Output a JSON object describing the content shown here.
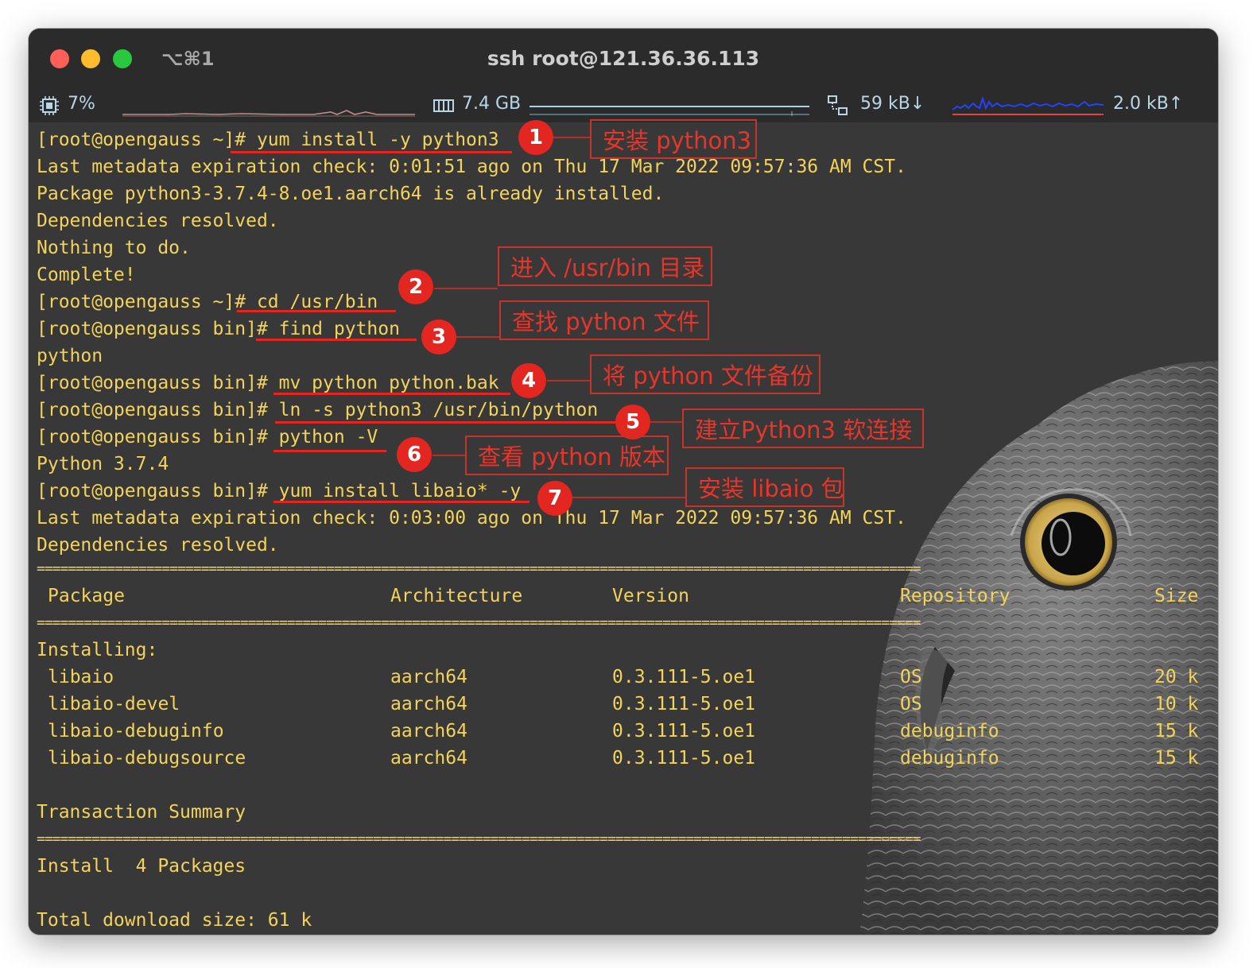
{
  "window": {
    "title": "ssh root@121.36.36.113",
    "tab_shortcut": "⌥⌘1"
  },
  "status_bar": {
    "cpu": "7%",
    "memory": "7.4 GB",
    "network_down": "59 kB↓",
    "network_up": "2.0 kB↑",
    "icons": [
      "cpu-icon",
      "memory-icon",
      "network-icon"
    ]
  },
  "terminal": {
    "lines": [
      "[root@opengauss ~]# yum install -y python3",
      "Last metadata expiration check: 0:01:51 ago on Thu 17 Mar 2022 09:57:36 AM CST.",
      "Package python3-3.7.4-8.oe1.aarch64 is already installed.",
      "Dependencies resolved.",
      "Nothing to do.",
      "Complete!",
      "[root@opengauss ~]# cd /usr/bin",
      "[root@opengauss bin]# find python",
      "python",
      "[root@opengauss bin]# mv python python.bak",
      "[root@opengauss bin]# ln -s python3 /usr/bin/python",
      "[root@opengauss bin]# python -V",
      "Python 3.7.4",
      "[root@opengauss bin]# yum install libaio* -y",
      "Last metadata expiration check: 0:03:00 ago on Thu 17 Mar 2022 09:57:36 AM CST.",
      "Dependencies resolved."
    ],
    "table": {
      "headers": [
        "Package",
        "Architecture",
        "Version",
        "Repository",
        "Size"
      ],
      "section": "Installing:",
      "rows": [
        [
          "libaio",
          "aarch64",
          "0.3.111-5.oe1",
          "OS",
          "20 k"
        ],
        [
          "libaio-devel",
          "aarch64",
          "0.3.111-5.oe1",
          "OS",
          "10 k"
        ],
        [
          "libaio-debuginfo",
          "aarch64",
          "0.3.111-5.oe1",
          "debuginfo",
          "15 k"
        ],
        [
          "libaio-debugsource",
          "aarch64",
          "0.3.111-5.oe1",
          "debuginfo",
          "15 k"
        ]
      ]
    },
    "summary_title": "Transaction Summary",
    "install_line": "Install  4 Packages",
    "total_line": "Total download size: 61 k"
  },
  "annotations": [
    {
      "number": "1",
      "label": "安装 python3"
    },
    {
      "number": "2",
      "label": "进入 /usr/bin 目录"
    },
    {
      "number": "3",
      "label": "查找 python 文件"
    },
    {
      "number": "4",
      "label": "将 python 文件备份"
    },
    {
      "number": "5",
      "label": "建立Python3 软连接"
    },
    {
      "number": "6",
      "label": "查看 python 版本"
    },
    {
      "number": "7",
      "label": "安装 libaio 包"
    }
  ],
  "colors": {
    "terminal_text": "#f3d35c",
    "terminal_bg": "#383838",
    "annotation_red": "#e3261f"
  }
}
